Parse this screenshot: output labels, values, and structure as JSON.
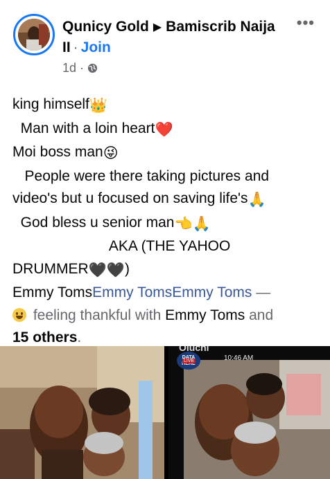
{
  "post": {
    "author": "Qunicy Gold",
    "arrow": "▶",
    "group": "Bamiscrib Naija II",
    "dot": "·",
    "join": "Join",
    "time": "1d",
    "time_sep": "·",
    "more": "•••"
  },
  "body": {
    "l1": "king himself",
    "l1_emoji": "👑",
    "l2": "  Man with a loin heart",
    "l2_emoji": "❤️",
    "l3": "Moi boss man",
    "l3_emoji": "😜",
    "l4": "   People were there taking pictures and",
    "l5": "video's but u focused on saving life's",
    "l5_emoji": "🙏",
    "l6": "  God bless u senior man",
    "l6_emoji": "👈🙏",
    "l7": "                        AKA (THE YAHOO",
    "l8a": "DRUMMER",
    "l8_emoji": "🖤🖤",
    "l8b": ")",
    "tag1": "Emmy Toms",
    "tag2": "Emmy Toms",
    "tag3": "Emmy Toms",
    "dash": " —",
    "feeling": " feeling thankful with ",
    "with_name": "Emmy Toms",
    "and": " and",
    "others": "15 others",
    "period": "."
  },
  "photos": {
    "right_watermark": "Oluchi",
    "right_time": "10:46 AM",
    "right_logo": "DATA HERE",
    "right_live": "LIVE"
  },
  "colors": {
    "link": "#385898",
    "join": "#1877f2",
    "meta": "#65676b"
  }
}
